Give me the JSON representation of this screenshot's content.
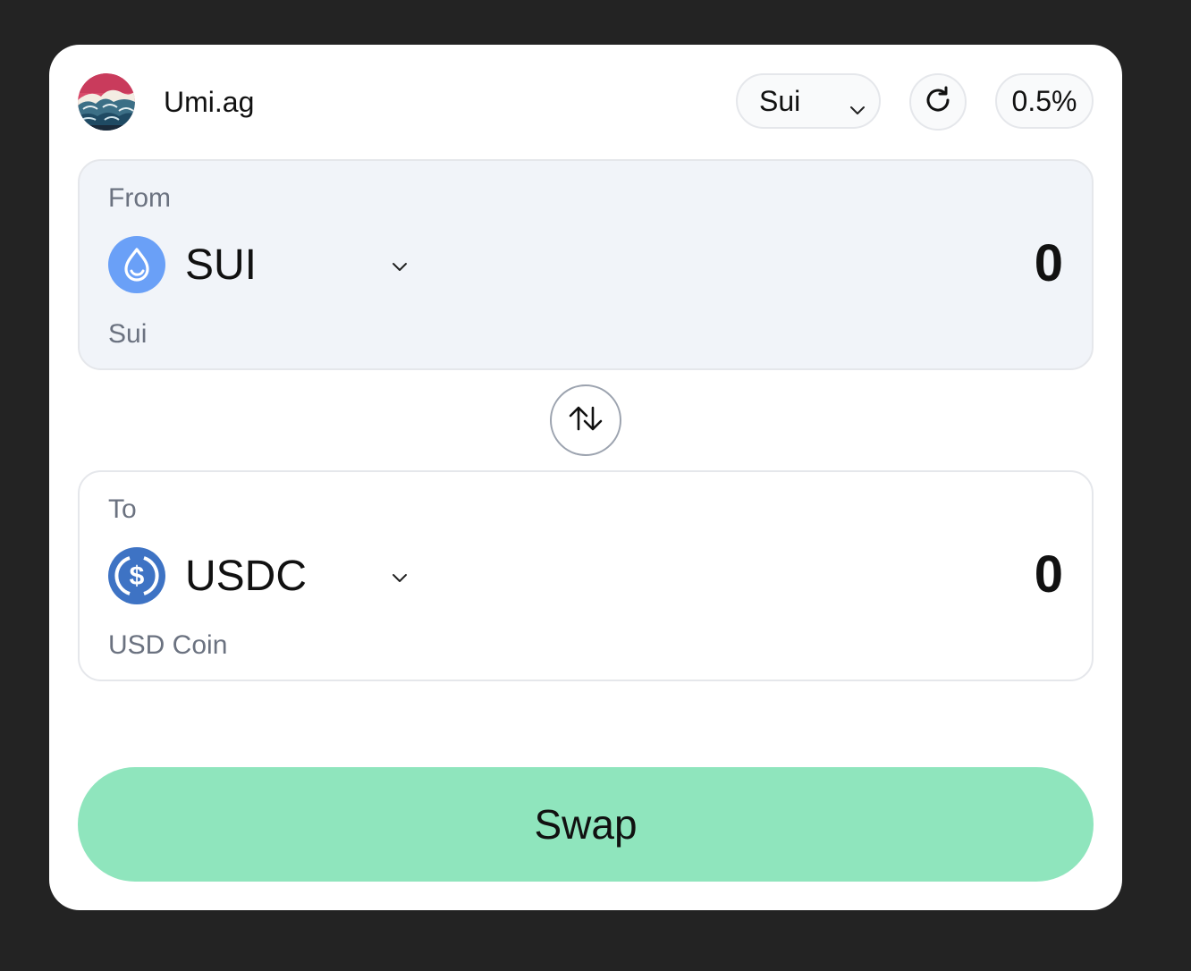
{
  "header": {
    "brand": "Umi.ag",
    "logo_icon": "great-wave-logo",
    "network_selected": "Sui",
    "refresh_icon": "refresh-icon",
    "slippage": "0.5%"
  },
  "from_panel": {
    "label": "From",
    "token_symbol": "SUI",
    "token_name": "Sui",
    "token_icon": "sui-drop-icon",
    "amount": "0",
    "background": "#f1f4f9"
  },
  "switch": {
    "icon": "arrows-up-down-icon"
  },
  "to_panel": {
    "label": "To",
    "token_symbol": "USDC",
    "token_name": "USD Coin",
    "token_icon": "usdc-icon",
    "amount": "0"
  },
  "swap_button": {
    "label": "Swap",
    "color": "#8fe5bd"
  },
  "colors": {
    "page_background": "#232323",
    "card_background": "#ffffff",
    "sui_blue": "#6aa0f7",
    "usdc_blue": "#3e73c4",
    "muted_text": "#6b7280"
  }
}
